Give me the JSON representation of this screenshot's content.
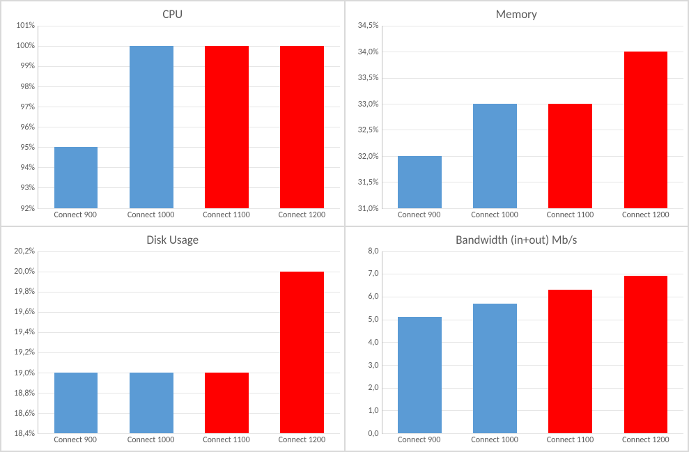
{
  "colors": {
    "blue": "#5B9BD5",
    "red": "#FF0000"
  },
  "categories": [
    "Connect 900",
    "Connect 1000",
    "Connect 1100",
    "Connect 1200"
  ],
  "chart_data": [
    {
      "id": "cpu",
      "type": "bar",
      "title": "CPU",
      "categories": [
        "Connect 900",
        "Connect 1000",
        "Connect 1100",
        "Connect 1200"
      ],
      "values": [
        95,
        100,
        100,
        100
      ],
      "bar_colors": [
        "blue",
        "blue",
        "red",
        "red"
      ],
      "ylim": [
        92,
        101
      ],
      "y_ticks": [
        92,
        93,
        94,
        95,
        96,
        97,
        98,
        99,
        100,
        101
      ],
      "y_tick_labels": [
        "92%",
        "93%",
        "94%",
        "95%",
        "96%",
        "97%",
        "98%",
        "99%",
        "100%",
        "101%"
      ],
      "xlabel": "",
      "ylabel": ""
    },
    {
      "id": "memory",
      "type": "bar",
      "title": "Memory",
      "categories": [
        "Connect 900",
        "Connect 1000",
        "Connect 1100",
        "Connect 1200"
      ],
      "values": [
        32.0,
        33.0,
        33.0,
        34.0
      ],
      "bar_colors": [
        "blue",
        "blue",
        "red",
        "red"
      ],
      "ylim": [
        31.0,
        34.5
      ],
      "y_ticks": [
        31.0,
        31.5,
        32.0,
        32.5,
        33.0,
        33.5,
        34.0,
        34.5
      ],
      "y_tick_labels": [
        "31,0%",
        "31,5%",
        "32,0%",
        "32,5%",
        "33,0%",
        "33,5%",
        "34,0%",
        "34,5%"
      ],
      "xlabel": "",
      "ylabel": ""
    },
    {
      "id": "disk",
      "type": "bar",
      "title": "Disk Usage",
      "categories": [
        "Connect 900",
        "Connect 1000",
        "Connect 1100",
        "Connect 1200"
      ],
      "values": [
        19.0,
        19.0,
        19.0,
        20.0
      ],
      "bar_colors": [
        "blue",
        "blue",
        "red",
        "red"
      ],
      "ylim": [
        18.4,
        20.2
      ],
      "y_ticks": [
        18.4,
        18.6,
        18.8,
        19.0,
        19.2,
        19.4,
        19.6,
        19.8,
        20.0,
        20.2
      ],
      "y_tick_labels": [
        "18,4%",
        "18,6%",
        "18,8%",
        "19,0%",
        "19,2%",
        "19,4%",
        "19,6%",
        "19,8%",
        "20,0%",
        "20,2%"
      ],
      "xlabel": "",
      "ylabel": ""
    },
    {
      "id": "bandwidth",
      "type": "bar",
      "title": "Bandwidth (in+out) Mb/s",
      "categories": [
        "Connect 900",
        "Connect 1000",
        "Connect 1100",
        "Connect 1200"
      ],
      "values": [
        5.1,
        5.7,
        6.3,
        6.9
      ],
      "bar_colors": [
        "blue",
        "blue",
        "red",
        "red"
      ],
      "ylim": [
        0.0,
        8.0
      ],
      "y_ticks": [
        0.0,
        1.0,
        2.0,
        3.0,
        4.0,
        5.0,
        6.0,
        7.0,
        8.0
      ],
      "y_tick_labels": [
        "0,0",
        "1,0",
        "2,0",
        "3,0",
        "4,0",
        "5,0",
        "6,0",
        "7,0",
        "8,0"
      ],
      "xlabel": "",
      "ylabel": ""
    }
  ]
}
